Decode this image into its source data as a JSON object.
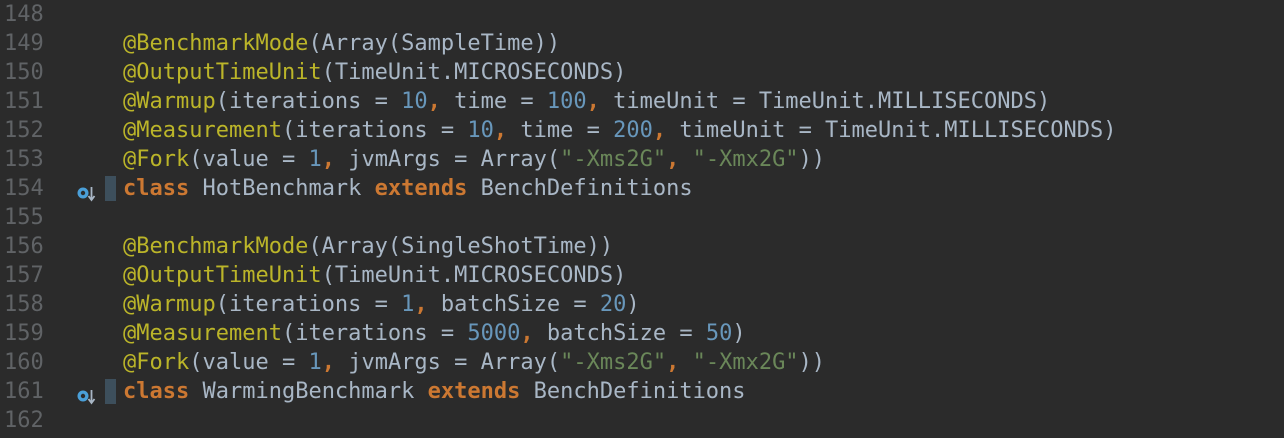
{
  "editor": {
    "theme": "dark",
    "colors": {
      "background": "#2b2b2b",
      "line_number": "#606366",
      "text": "#a9b7c6",
      "annotation": "#bbb529",
      "keyword": "#cc7832",
      "number": "#6897bb",
      "string": "#6a8759"
    },
    "lines": [
      {
        "number": "148",
        "tokens": []
      },
      {
        "number": "149",
        "tokens": [
          {
            "type": "ann",
            "text": "@BenchmarkMode"
          },
          {
            "type": "plain",
            "text": "(Array(SampleTime))"
          }
        ]
      },
      {
        "number": "150",
        "tokens": [
          {
            "type": "ann",
            "text": "@OutputTimeUnit"
          },
          {
            "type": "plain",
            "text": "(TimeUnit.MICROSECONDS)"
          }
        ]
      },
      {
        "number": "151",
        "tokens": [
          {
            "type": "ann",
            "text": "@Warmup"
          },
          {
            "type": "plain",
            "text": "(iterations = "
          },
          {
            "type": "num",
            "text": "10"
          },
          {
            "type": "kw",
            "text": ", "
          },
          {
            "type": "plain",
            "text": "time = "
          },
          {
            "type": "num",
            "text": "100"
          },
          {
            "type": "kw",
            "text": ", "
          },
          {
            "type": "plain",
            "text": "timeUnit = TimeUnit.MILLISECONDS)"
          }
        ]
      },
      {
        "number": "152",
        "tokens": [
          {
            "type": "ann",
            "text": "@Measurement"
          },
          {
            "type": "plain",
            "text": "(iterations = "
          },
          {
            "type": "num",
            "text": "10"
          },
          {
            "type": "kw",
            "text": ", "
          },
          {
            "type": "plain",
            "text": "time = "
          },
          {
            "type": "num",
            "text": "200"
          },
          {
            "type": "kw",
            "text": ", "
          },
          {
            "type": "plain",
            "text": "timeUnit = TimeUnit.MILLISECONDS)"
          }
        ]
      },
      {
        "number": "153",
        "tokens": [
          {
            "type": "ann",
            "text": "@Fork"
          },
          {
            "type": "plain",
            "text": "(value = "
          },
          {
            "type": "num",
            "text": "1"
          },
          {
            "type": "kw",
            "text": ", "
          },
          {
            "type": "plain",
            "text": "jvmArgs = Array("
          },
          {
            "type": "str",
            "text": "\"-Xms2G\""
          },
          {
            "type": "kw",
            "text": ", "
          },
          {
            "type": "str",
            "text": "\"-Xmx2G\""
          },
          {
            "type": "plain",
            "text": "))"
          }
        ]
      },
      {
        "number": "154",
        "gutter_icon": "implemented-override-icon",
        "tokens": [
          {
            "type": "kw",
            "text": "class "
          },
          {
            "type": "plain",
            "text": "HotBenchmark "
          },
          {
            "type": "kw",
            "text": "extends "
          },
          {
            "type": "plain",
            "text": "BenchDefinitions"
          }
        ]
      },
      {
        "number": "155",
        "tokens": []
      },
      {
        "number": "156",
        "tokens": [
          {
            "type": "ann",
            "text": "@BenchmarkMode"
          },
          {
            "type": "plain",
            "text": "(Array(SingleShotTime))"
          }
        ]
      },
      {
        "number": "157",
        "tokens": [
          {
            "type": "ann",
            "text": "@OutputTimeUnit"
          },
          {
            "type": "plain",
            "text": "(TimeUnit.MICROSECONDS)"
          }
        ]
      },
      {
        "number": "158",
        "tokens": [
          {
            "type": "ann",
            "text": "@Warmup"
          },
          {
            "type": "plain",
            "text": "(iterations = "
          },
          {
            "type": "num",
            "text": "1"
          },
          {
            "type": "kw",
            "text": ", "
          },
          {
            "type": "plain",
            "text": "batchSize = "
          },
          {
            "type": "num",
            "text": "20"
          },
          {
            "type": "plain",
            "text": ")"
          }
        ]
      },
      {
        "number": "159",
        "tokens": [
          {
            "type": "ann",
            "text": "@Measurement"
          },
          {
            "type": "plain",
            "text": "(iterations = "
          },
          {
            "type": "num",
            "text": "5000"
          },
          {
            "type": "kw",
            "text": ", "
          },
          {
            "type": "plain",
            "text": "batchSize = "
          },
          {
            "type": "num",
            "text": "50"
          },
          {
            "type": "plain",
            "text": ")"
          }
        ]
      },
      {
        "number": "160",
        "tokens": [
          {
            "type": "ann",
            "text": "@Fork"
          },
          {
            "type": "plain",
            "text": "(value = "
          },
          {
            "type": "num",
            "text": "1"
          },
          {
            "type": "kw",
            "text": ", "
          },
          {
            "type": "plain",
            "text": "jvmArgs = Array("
          },
          {
            "type": "str",
            "text": "\"-Xms2G\""
          },
          {
            "type": "kw",
            "text": ", "
          },
          {
            "type": "str",
            "text": "\"-Xmx2G\""
          },
          {
            "type": "plain",
            "text": "))"
          }
        ]
      },
      {
        "number": "161",
        "gutter_icon": "implemented-override-icon",
        "tokens": [
          {
            "type": "kw",
            "text": "class "
          },
          {
            "type": "plain",
            "text": "WarmingBenchmark "
          },
          {
            "type": "kw",
            "text": "extends "
          },
          {
            "type": "plain",
            "text": "BenchDefinitions"
          }
        ]
      },
      {
        "number": "162",
        "tokens": []
      }
    ]
  }
}
